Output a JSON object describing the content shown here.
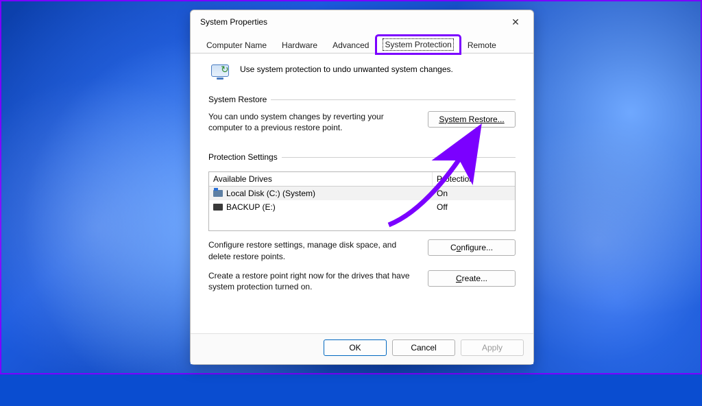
{
  "window": {
    "title": "System Properties"
  },
  "tabs": {
    "items": [
      "Computer Name",
      "Hardware",
      "Advanced",
      "System Protection",
      "Remote"
    ],
    "active_index": 3
  },
  "intro_text": "Use system protection to undo unwanted system changes.",
  "system_restore": {
    "legend": "System Restore",
    "text": "You can undo system changes by reverting your computer to a previous restore point.",
    "button": "System Restore..."
  },
  "protection_settings": {
    "legend": "Protection Settings",
    "columns": [
      "Available Drives",
      "Protection"
    ],
    "rows": [
      {
        "icon": "win",
        "label": "Local Disk (C:) (System)",
        "protection": "On",
        "selected": true
      },
      {
        "icon": "dark",
        "label": "BACKUP (E:)",
        "protection": "Off",
        "selected": false
      }
    ],
    "configure_text": "Configure restore settings, manage disk space, and delete restore points.",
    "configure_button": "Configure...",
    "create_text": "Create a restore point right now for the drives that have system protection turned on.",
    "create_button": "Create..."
  },
  "footer": {
    "ok": "OK",
    "cancel": "Cancel",
    "apply": "Apply"
  },
  "annotation": {
    "highlight_tab_index": 3,
    "arrow_target": "system-restore-button"
  }
}
